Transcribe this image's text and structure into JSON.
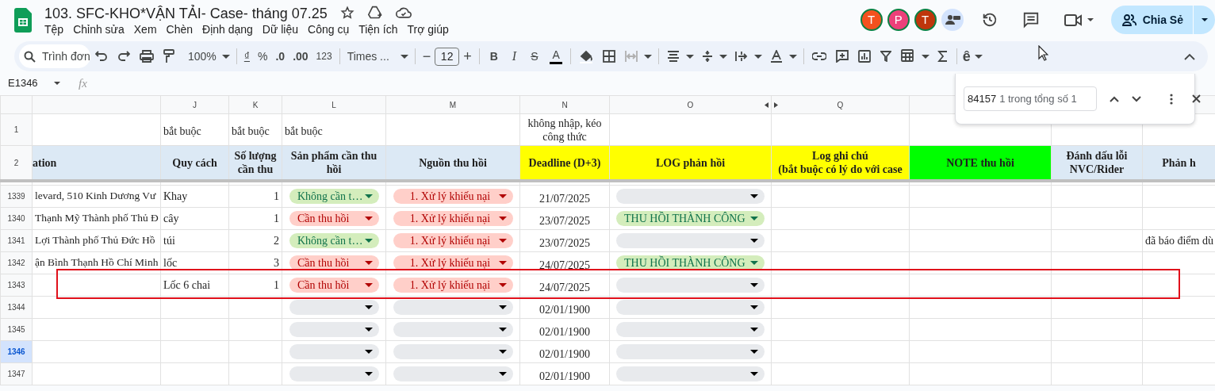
{
  "document": {
    "title": "103. SFC-KHO*VẬN TẢI- Case- tháng 07.25"
  },
  "menu": [
    "Tệp",
    "Chỉnh sửa",
    "Xem",
    "Chèn",
    "Định dạng",
    "Dữ liệu",
    "Công cụ",
    "Tiện ích",
    "Trợ giúp"
  ],
  "collaborators": [
    {
      "initial": "T",
      "color": "#f4511e"
    },
    {
      "initial": "P",
      "color": "#ec407a"
    },
    {
      "initial": "T",
      "color": "#bf360c"
    }
  ],
  "share_button": {
    "label": "Chia Sẻ"
  },
  "toolbar": {
    "search_placeholder": "Trình đơn",
    "zoom": "100%",
    "currency": "₫",
    "percent": "%",
    "decrease_decimal": ".0",
    "increase_decimal": ".00",
    "number_format": "123",
    "font": "Times ...",
    "decrease_size": "−",
    "font_size": "12",
    "increase_size": "+",
    "bold": "B",
    "italic": "I",
    "strikethrough": "S",
    "text_color": "A",
    "input_tools": "ê"
  },
  "name_box": "E1346",
  "function_label": "fx",
  "find_bar": {
    "value": "84157",
    "result": "1 trong tổng số 1"
  },
  "columns": [
    {},
    {
      "letter": "J"
    },
    {
      "letter": "K"
    },
    {
      "letter": "L"
    },
    {
      "letter": "M"
    },
    {
      "letter": "N"
    },
    {
      "letter": "O",
      "hidden_after": true
    },
    {
      "letter": "Q",
      "hidden_before": true
    },
    {},
    {},
    {}
  ],
  "row_1": {
    "number": "1",
    "J": "bắt buộc",
    "K": "bắt buộc",
    "L": "bắt buộc",
    "N": "không nhập, kéo công thức"
  },
  "row_2": {
    "number": "2",
    "cells": [
      {
        "text": "ation",
        "color": "#dce9f5"
      },
      {
        "text": "Quy cách",
        "color": "#dce9f5"
      },
      {
        "text": "Số lượng cần thu",
        "color": "#dce9f5"
      },
      {
        "text": "Sản phẩm cần thu hồi",
        "color": "#dce9f5"
      },
      {
        "text": "Nguồn thu hồi",
        "color": "#dce9f5"
      },
      {
        "text": "Deadline (D+3)",
        "color": "#ffff00"
      },
      {
        "text": "LOG phản hồi",
        "color": "#ffff00"
      },
      {
        "text": "Log ghi chú\n(bắt buộc có lý do với case",
        "color": "#ffff00"
      },
      {
        "text": "NOTE thu hồi",
        "color": "#00ff00"
      },
      {
        "text": "Đánh dấu lỗi NVC/Rider",
        "color": "#dce9f5"
      },
      {
        "text": "Phản h",
        "color": "#dce9f5"
      }
    ]
  },
  "rows": [
    {
      "number": "1339",
      "selected": false,
      "highlighted": false,
      "column_1": "levard, 510 Kinh Dương Vư",
      "spec": "Khay",
      "quantity": "1",
      "product": {
        "kind": "positive",
        "label": "Không cần t…"
      },
      "source": {
        "kind": "negative",
        "label": "1. Xử lý khiếu nại"
      },
      "deadline": "21/07/2025",
      "log": {
        "kind": "empty"
      }
    },
    {
      "number": "1340",
      "selected": false,
      "highlighted": false,
      "column_1": "Thạnh Mỹ Thành phố Thủ Đ",
      "spec": "cây",
      "quantity": "1",
      "product": {
        "kind": "negative",
        "label": "Cần thu hồi"
      },
      "source": {
        "kind": "negative",
        "label": "1. Xử lý khiếu nại"
      },
      "deadline": "23/07/2025",
      "log": {
        "kind": "positive",
        "label": "THU HỒI THÀNH CÔNG"
      }
    },
    {
      "number": "1341",
      "selected": false,
      "highlighted": false,
      "column_1": "Lợi Thành phố Thủ Đức Hồ",
      "spec": "túi",
      "quantity": "2",
      "product": {
        "kind": "positive",
        "label": "Không cần t…"
      },
      "source": {
        "kind": "negative",
        "label": "1. Xử lý khiếu nại"
      },
      "deadline": "23/07/2025",
      "log": {
        "kind": "empty"
      },
      "last_column": "đã báo điểm dù"
    },
    {
      "number": "1342",
      "selected": false,
      "highlighted": false,
      "column_1": "ận Bình Thạnh Hồ Chí Minh",
      "spec": "lốc",
      "quantity": "3",
      "product": {
        "kind": "negative",
        "label": "Cần thu hồi"
      },
      "source": {
        "kind": "negative",
        "label": "1. Xử lý khiếu nại"
      },
      "deadline": "24/07/2025",
      "log": {
        "kind": "positive",
        "label": "THU HỒI THÀNH CÔNG"
      }
    },
    {
      "number": "1343",
      "selected": false,
      "highlighted": true,
      "spec": "Lốc 6 chai",
      "quantity": "1",
      "product": {
        "kind": "negative",
        "label": "Cần thu hồi"
      },
      "source": {
        "kind": "negative",
        "label": "1. Xử lý khiếu nại"
      },
      "deadline": "24/07/2025",
      "log": {
        "kind": "empty"
      }
    },
    {
      "number": "1344",
      "selected": false,
      "highlighted": false,
      "product": {
        "kind": "empty"
      },
      "source": {
        "kind": "empty"
      },
      "deadline": "02/01/1900",
      "log": {
        "kind": "empty"
      }
    },
    {
      "number": "1345",
      "selected": false,
      "highlighted": false,
      "product": {
        "kind": "empty"
      },
      "source": {
        "kind": "empty"
      },
      "deadline": "02/01/1900",
      "log": {
        "kind": "empty"
      }
    },
    {
      "number": "1346",
      "selected": true,
      "highlighted": false,
      "product": {
        "kind": "empty"
      },
      "source": {
        "kind": "empty"
      },
      "deadline": "02/01/1900",
      "log": {
        "kind": "empty"
      }
    },
    {
      "number": "1347",
      "selected": false,
      "highlighted": false,
      "product": {
        "kind": "empty"
      },
      "source": {
        "kind": "empty"
      },
      "deadline": "02/01/1900",
      "log": {
        "kind": "empty"
      }
    }
  ]
}
